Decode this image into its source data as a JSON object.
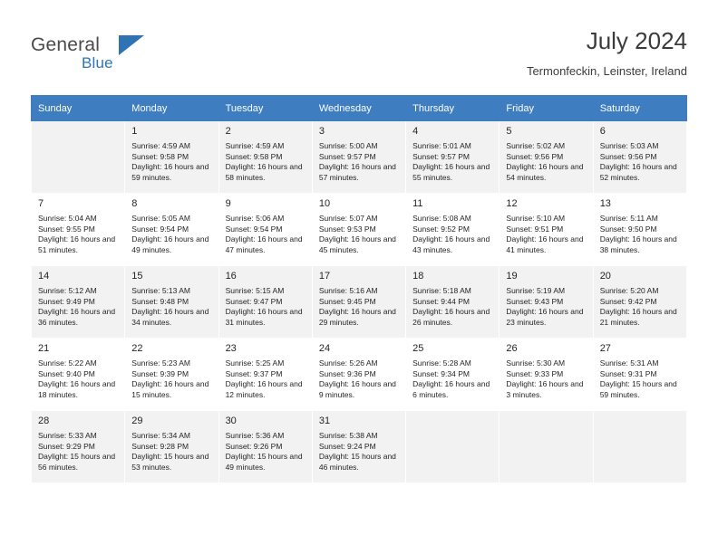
{
  "brand": {
    "name_part1": "General",
    "name_part2": "Blue",
    "flag_icon": "blue-triangle-flag-icon"
  },
  "header": {
    "title": "July 2024",
    "location": "Termonfeckin, Leinster, Ireland"
  },
  "calendar": {
    "weekdays": [
      "Sunday",
      "Monday",
      "Tuesday",
      "Wednesday",
      "Thursday",
      "Friday",
      "Saturday"
    ],
    "header_bg": "#3e7dbf",
    "row_alt_bg": "#f2f2f2",
    "weeks": [
      [
        {
          "day": "",
          "sunrise": "",
          "sunset": "",
          "daylight": ""
        },
        {
          "day": "1",
          "sunrise": "Sunrise: 4:59 AM",
          "sunset": "Sunset: 9:58 PM",
          "daylight": "Daylight: 16 hours and 59 minutes."
        },
        {
          "day": "2",
          "sunrise": "Sunrise: 4:59 AM",
          "sunset": "Sunset: 9:58 PM",
          "daylight": "Daylight: 16 hours and 58 minutes."
        },
        {
          "day": "3",
          "sunrise": "Sunrise: 5:00 AM",
          "sunset": "Sunset: 9:57 PM",
          "daylight": "Daylight: 16 hours and 57 minutes."
        },
        {
          "day": "4",
          "sunrise": "Sunrise: 5:01 AM",
          "sunset": "Sunset: 9:57 PM",
          "daylight": "Daylight: 16 hours and 55 minutes."
        },
        {
          "day": "5",
          "sunrise": "Sunrise: 5:02 AM",
          "sunset": "Sunset: 9:56 PM",
          "daylight": "Daylight: 16 hours and 54 minutes."
        },
        {
          "day": "6",
          "sunrise": "Sunrise: 5:03 AM",
          "sunset": "Sunset: 9:56 PM",
          "daylight": "Daylight: 16 hours and 52 minutes."
        }
      ],
      [
        {
          "day": "7",
          "sunrise": "Sunrise: 5:04 AM",
          "sunset": "Sunset: 9:55 PM",
          "daylight": "Daylight: 16 hours and 51 minutes."
        },
        {
          "day": "8",
          "sunrise": "Sunrise: 5:05 AM",
          "sunset": "Sunset: 9:54 PM",
          "daylight": "Daylight: 16 hours and 49 minutes."
        },
        {
          "day": "9",
          "sunrise": "Sunrise: 5:06 AM",
          "sunset": "Sunset: 9:54 PM",
          "daylight": "Daylight: 16 hours and 47 minutes."
        },
        {
          "day": "10",
          "sunrise": "Sunrise: 5:07 AM",
          "sunset": "Sunset: 9:53 PM",
          "daylight": "Daylight: 16 hours and 45 minutes."
        },
        {
          "day": "11",
          "sunrise": "Sunrise: 5:08 AM",
          "sunset": "Sunset: 9:52 PM",
          "daylight": "Daylight: 16 hours and 43 minutes."
        },
        {
          "day": "12",
          "sunrise": "Sunrise: 5:10 AM",
          "sunset": "Sunset: 9:51 PM",
          "daylight": "Daylight: 16 hours and 41 minutes."
        },
        {
          "day": "13",
          "sunrise": "Sunrise: 5:11 AM",
          "sunset": "Sunset: 9:50 PM",
          "daylight": "Daylight: 16 hours and 38 minutes."
        }
      ],
      [
        {
          "day": "14",
          "sunrise": "Sunrise: 5:12 AM",
          "sunset": "Sunset: 9:49 PM",
          "daylight": "Daylight: 16 hours and 36 minutes."
        },
        {
          "day": "15",
          "sunrise": "Sunrise: 5:13 AM",
          "sunset": "Sunset: 9:48 PM",
          "daylight": "Daylight: 16 hours and 34 minutes."
        },
        {
          "day": "16",
          "sunrise": "Sunrise: 5:15 AM",
          "sunset": "Sunset: 9:47 PM",
          "daylight": "Daylight: 16 hours and 31 minutes."
        },
        {
          "day": "17",
          "sunrise": "Sunrise: 5:16 AM",
          "sunset": "Sunset: 9:45 PM",
          "daylight": "Daylight: 16 hours and 29 minutes."
        },
        {
          "day": "18",
          "sunrise": "Sunrise: 5:18 AM",
          "sunset": "Sunset: 9:44 PM",
          "daylight": "Daylight: 16 hours and 26 minutes."
        },
        {
          "day": "19",
          "sunrise": "Sunrise: 5:19 AM",
          "sunset": "Sunset: 9:43 PM",
          "daylight": "Daylight: 16 hours and 23 minutes."
        },
        {
          "day": "20",
          "sunrise": "Sunrise: 5:20 AM",
          "sunset": "Sunset: 9:42 PM",
          "daylight": "Daylight: 16 hours and 21 minutes."
        }
      ],
      [
        {
          "day": "21",
          "sunrise": "Sunrise: 5:22 AM",
          "sunset": "Sunset: 9:40 PM",
          "daylight": "Daylight: 16 hours and 18 minutes."
        },
        {
          "day": "22",
          "sunrise": "Sunrise: 5:23 AM",
          "sunset": "Sunset: 9:39 PM",
          "daylight": "Daylight: 16 hours and 15 minutes."
        },
        {
          "day": "23",
          "sunrise": "Sunrise: 5:25 AM",
          "sunset": "Sunset: 9:37 PM",
          "daylight": "Daylight: 16 hours and 12 minutes."
        },
        {
          "day": "24",
          "sunrise": "Sunrise: 5:26 AM",
          "sunset": "Sunset: 9:36 PM",
          "daylight": "Daylight: 16 hours and 9 minutes."
        },
        {
          "day": "25",
          "sunrise": "Sunrise: 5:28 AM",
          "sunset": "Sunset: 9:34 PM",
          "daylight": "Daylight: 16 hours and 6 minutes."
        },
        {
          "day": "26",
          "sunrise": "Sunrise: 5:30 AM",
          "sunset": "Sunset: 9:33 PM",
          "daylight": "Daylight: 16 hours and 3 minutes."
        },
        {
          "day": "27",
          "sunrise": "Sunrise: 5:31 AM",
          "sunset": "Sunset: 9:31 PM",
          "daylight": "Daylight: 15 hours and 59 minutes."
        }
      ],
      [
        {
          "day": "28",
          "sunrise": "Sunrise: 5:33 AM",
          "sunset": "Sunset: 9:29 PM",
          "daylight": "Daylight: 15 hours and 56 minutes."
        },
        {
          "day": "29",
          "sunrise": "Sunrise: 5:34 AM",
          "sunset": "Sunset: 9:28 PM",
          "daylight": "Daylight: 15 hours and 53 minutes."
        },
        {
          "day": "30",
          "sunrise": "Sunrise: 5:36 AM",
          "sunset": "Sunset: 9:26 PM",
          "daylight": "Daylight: 15 hours and 49 minutes."
        },
        {
          "day": "31",
          "sunrise": "Sunrise: 5:38 AM",
          "sunset": "Sunset: 9:24 PM",
          "daylight": "Daylight: 15 hours and 46 minutes."
        },
        {
          "day": "",
          "sunrise": "",
          "sunset": "",
          "daylight": ""
        },
        {
          "day": "",
          "sunrise": "",
          "sunset": "",
          "daylight": ""
        },
        {
          "day": "",
          "sunrise": "",
          "sunset": "",
          "daylight": ""
        }
      ]
    ]
  }
}
